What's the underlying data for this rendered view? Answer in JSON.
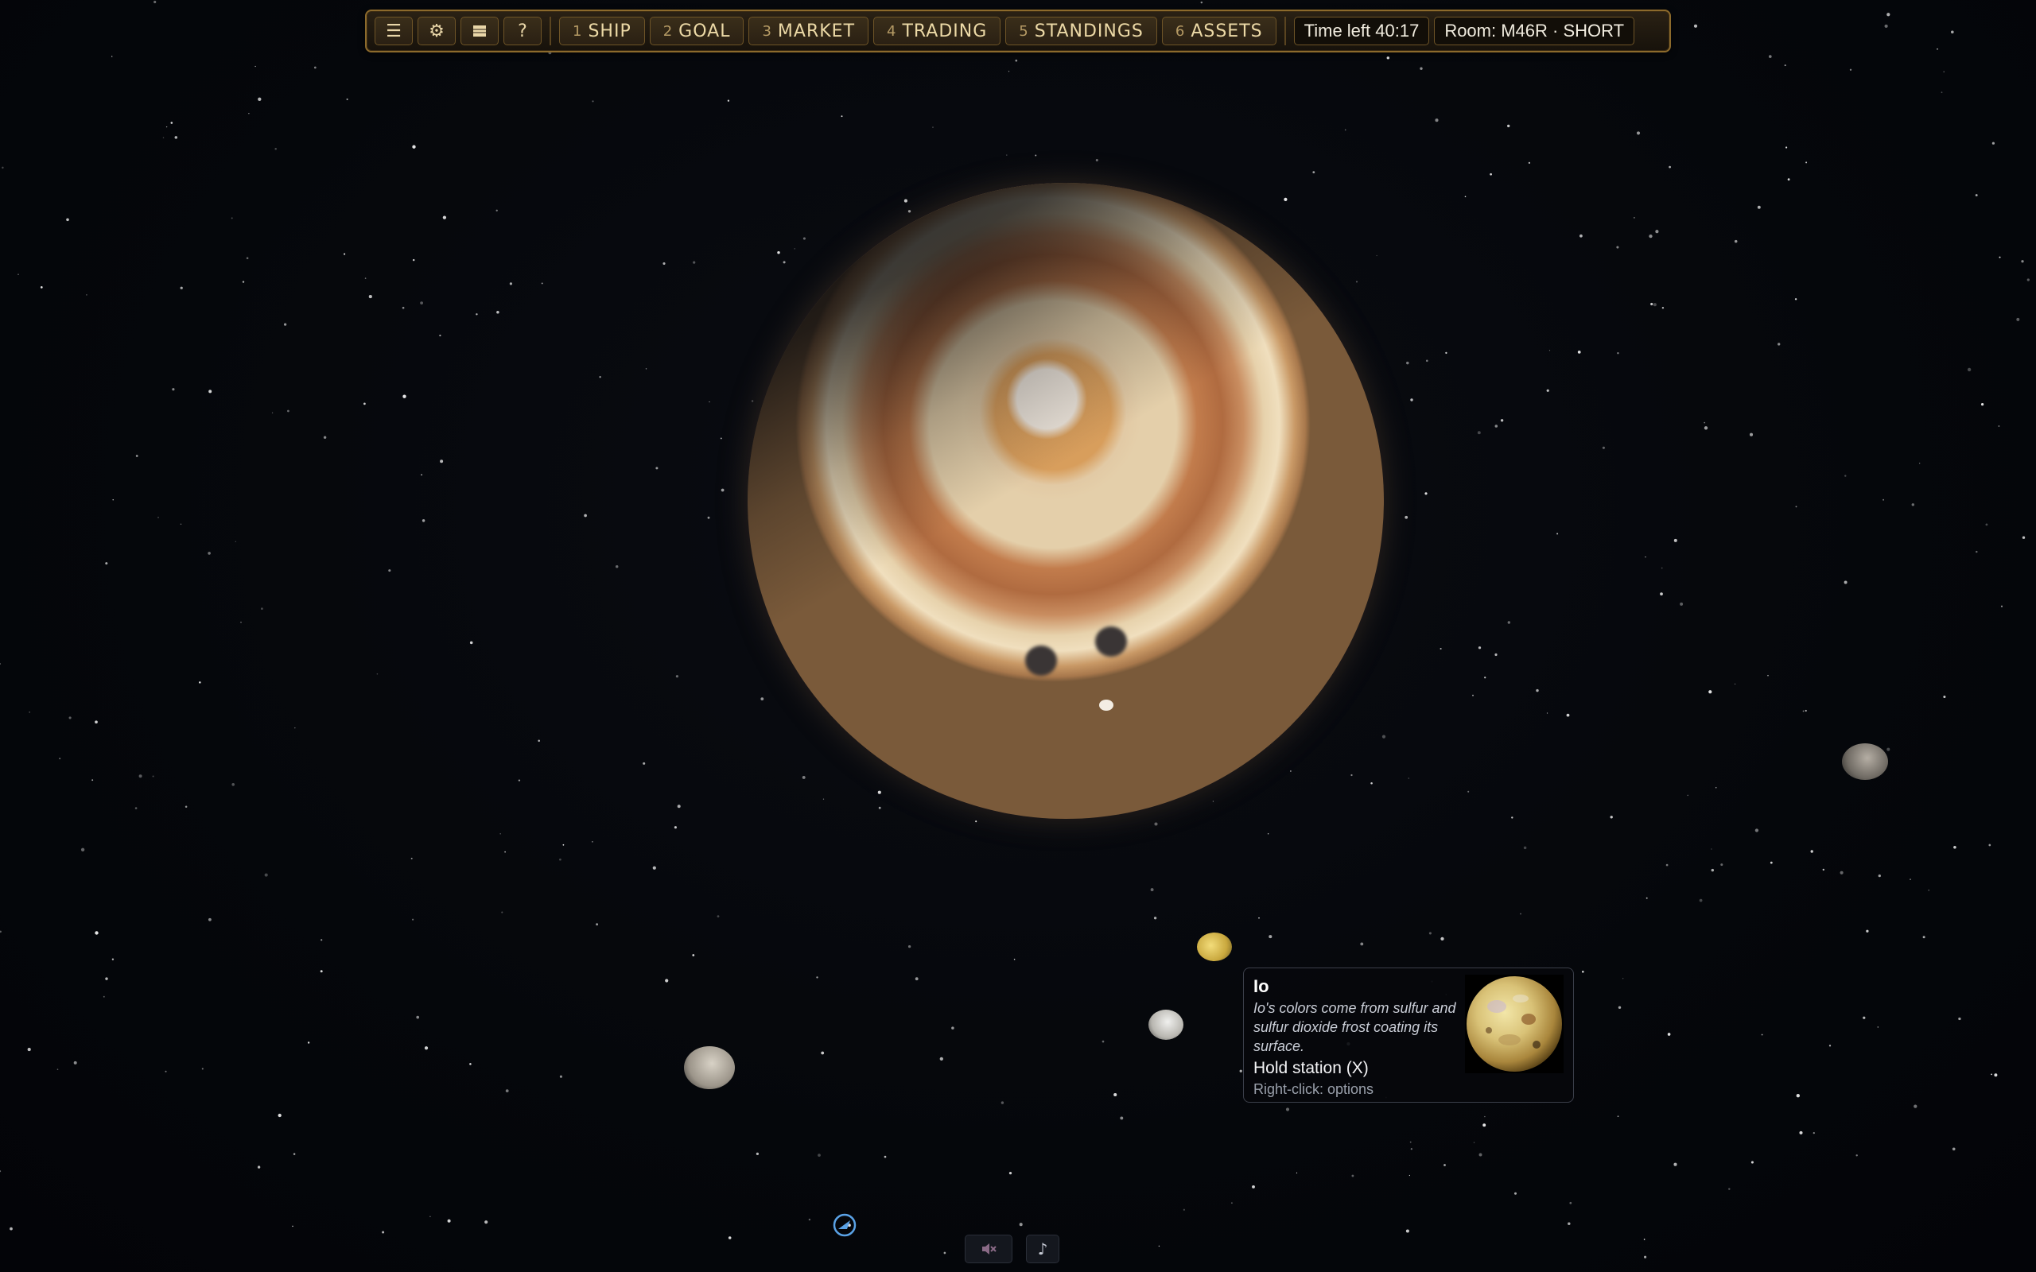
{
  "toolbar": {
    "icons": [
      "menu-icon",
      "gear-icon",
      "grid-icon",
      "help-icon"
    ],
    "help_label": "?",
    "tabs": [
      {
        "num": "1",
        "label": "SHIP"
      },
      {
        "num": "2",
        "label": "GOAL"
      },
      {
        "num": "3",
        "label": "MARKET"
      },
      {
        "num": "4",
        "label": "TRADING"
      },
      {
        "num": "5",
        "label": "STANDINGS"
      },
      {
        "num": "6",
        "label": "ASSETS"
      }
    ],
    "time_left": "Time left 40:17",
    "room": "Room: M46R · SHORT"
  },
  "tooltip": {
    "title": "Io",
    "description": "Io's colors come from sulfur and sulfur dioxide frost coating its surface.",
    "action": "Hold station (X)",
    "hint": "Right-click: options"
  },
  "bottom_controls": {
    "mute_icon": "mute-icon",
    "music_icon": "music-note-icon"
  },
  "colors": {
    "toolbar_border": "#8c6a2c",
    "toolbar_text": "#ecd9a6",
    "ship_marker": "#5aa2e6"
  }
}
